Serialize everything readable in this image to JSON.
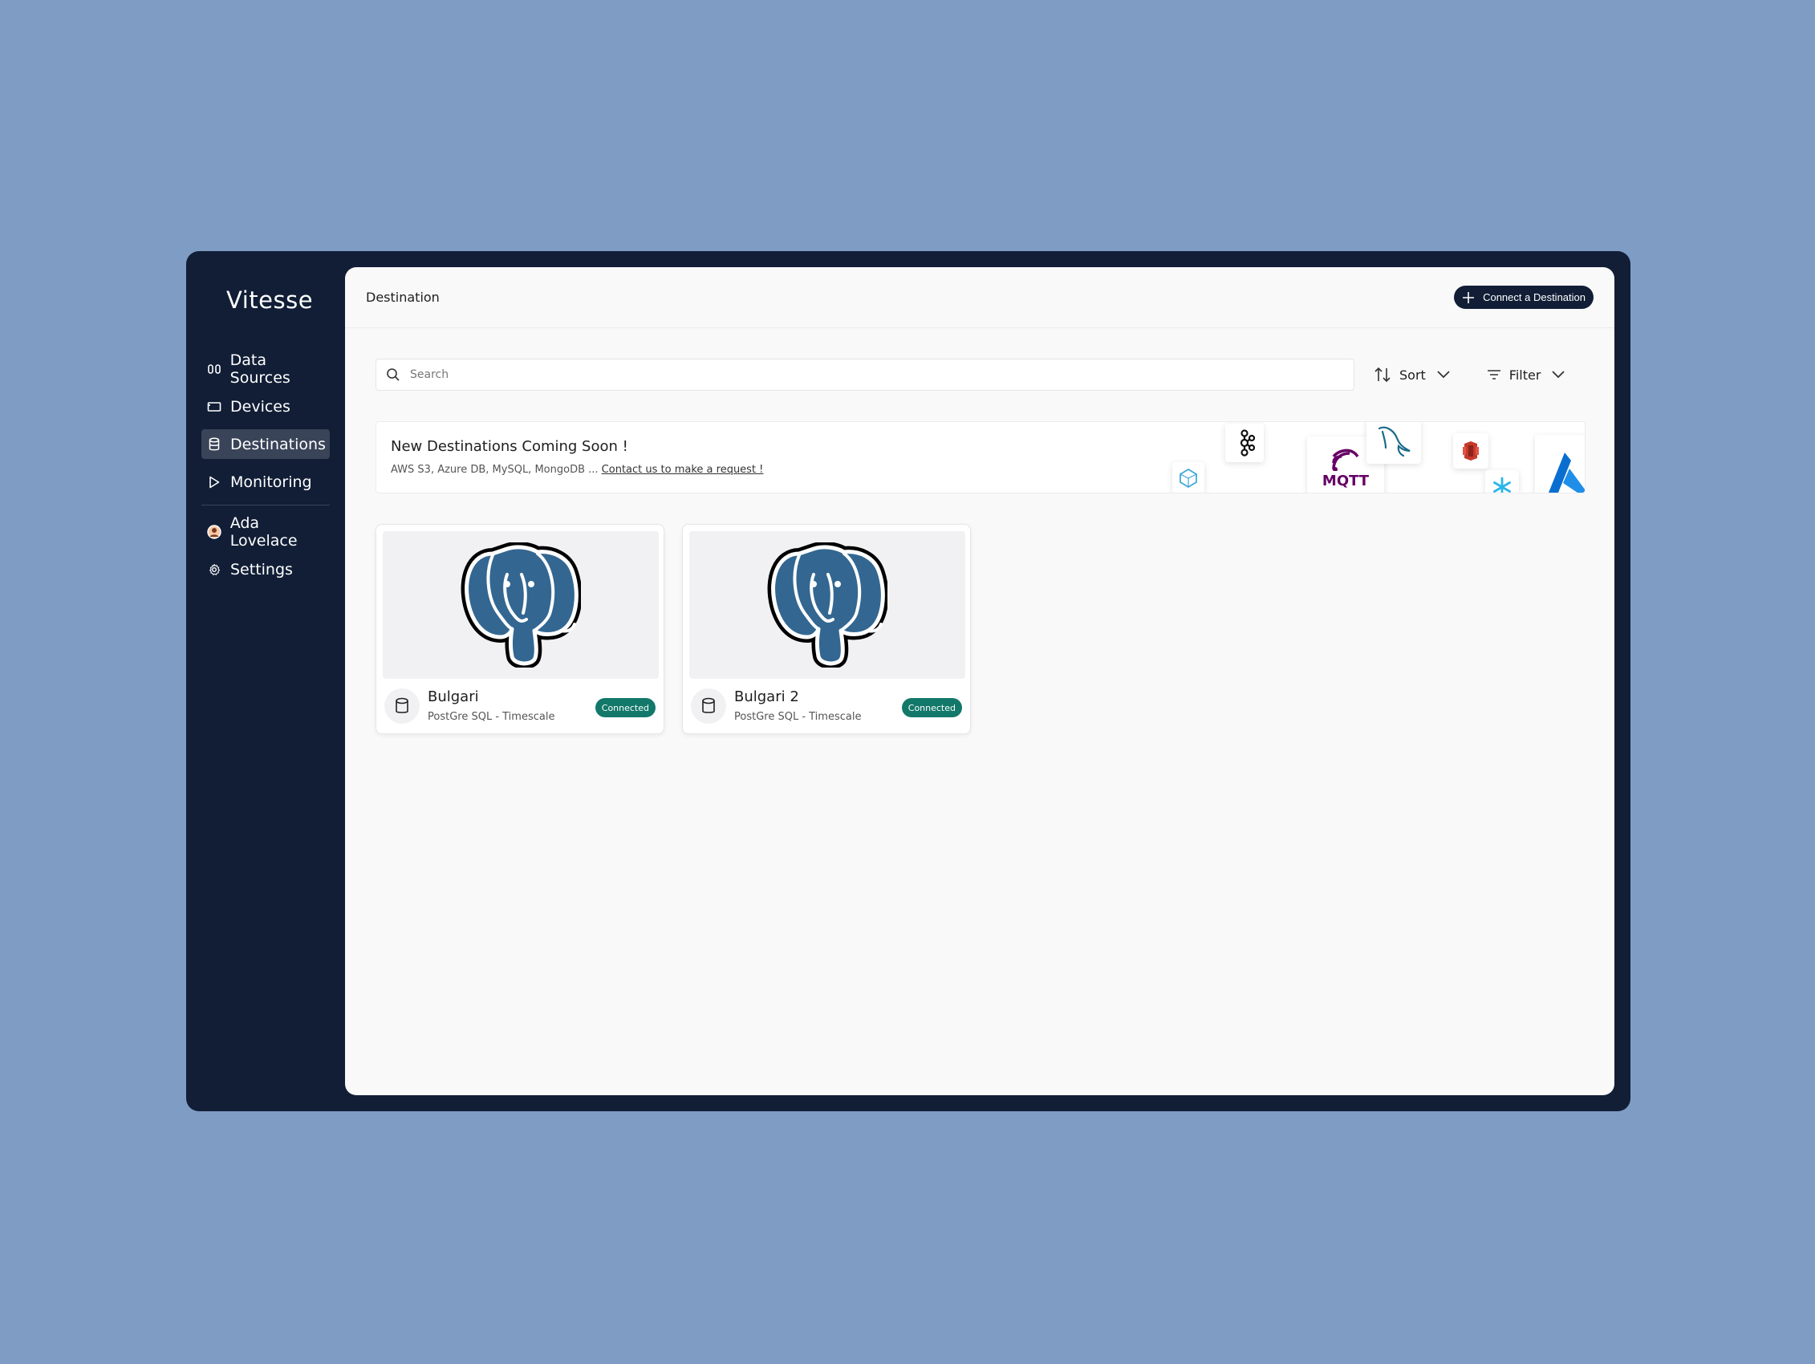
{
  "app": {
    "brand": "Vitesse"
  },
  "sidebar": {
    "items": [
      {
        "label": "Data Sources",
        "icon": "data-sources-icon"
      },
      {
        "label": "Devices",
        "icon": "devices-icon"
      },
      {
        "label": "Destinations",
        "icon": "database-icon",
        "active": true
      },
      {
        "label": "Monitoring",
        "icon": "play-icon"
      }
    ],
    "user": {
      "label": "Ada Lovelace",
      "icon": "avatar-icon"
    },
    "settings": {
      "label": "Settings",
      "icon": "gear-icon"
    }
  },
  "header": {
    "title": "Destination",
    "connect_label": "Connect a Destination"
  },
  "toolbar": {
    "search_placeholder": "Search",
    "sort_label": "Sort",
    "filter_label": "Filter"
  },
  "banner": {
    "title": "New Destinations Coming Soon !",
    "subtitle": "AWS S3, Azure DB, MySQL, MongoDB ...",
    "link": "Contact us to make a request !",
    "logos": [
      "kafka-logo",
      "mqtt-logo",
      "mysql-logo",
      "aws-s3-logo",
      "snowflake-logo",
      "azure-logo",
      "cube-logo"
    ],
    "mqtt_text": "MQTT"
  },
  "destinations": [
    {
      "name": "Bulgari",
      "type": "PostGre SQL - Timescale",
      "status": "Connected"
    },
    {
      "name": "Bulgari 2",
      "type": "PostGre SQL - Timescale",
      "status": "Connected"
    }
  ],
  "colors": {
    "background": "#7f9cc4",
    "sidebar": "#111e36",
    "accent": "#111e36",
    "status_connected": "#12786a",
    "postgres_blue": "#336791"
  }
}
